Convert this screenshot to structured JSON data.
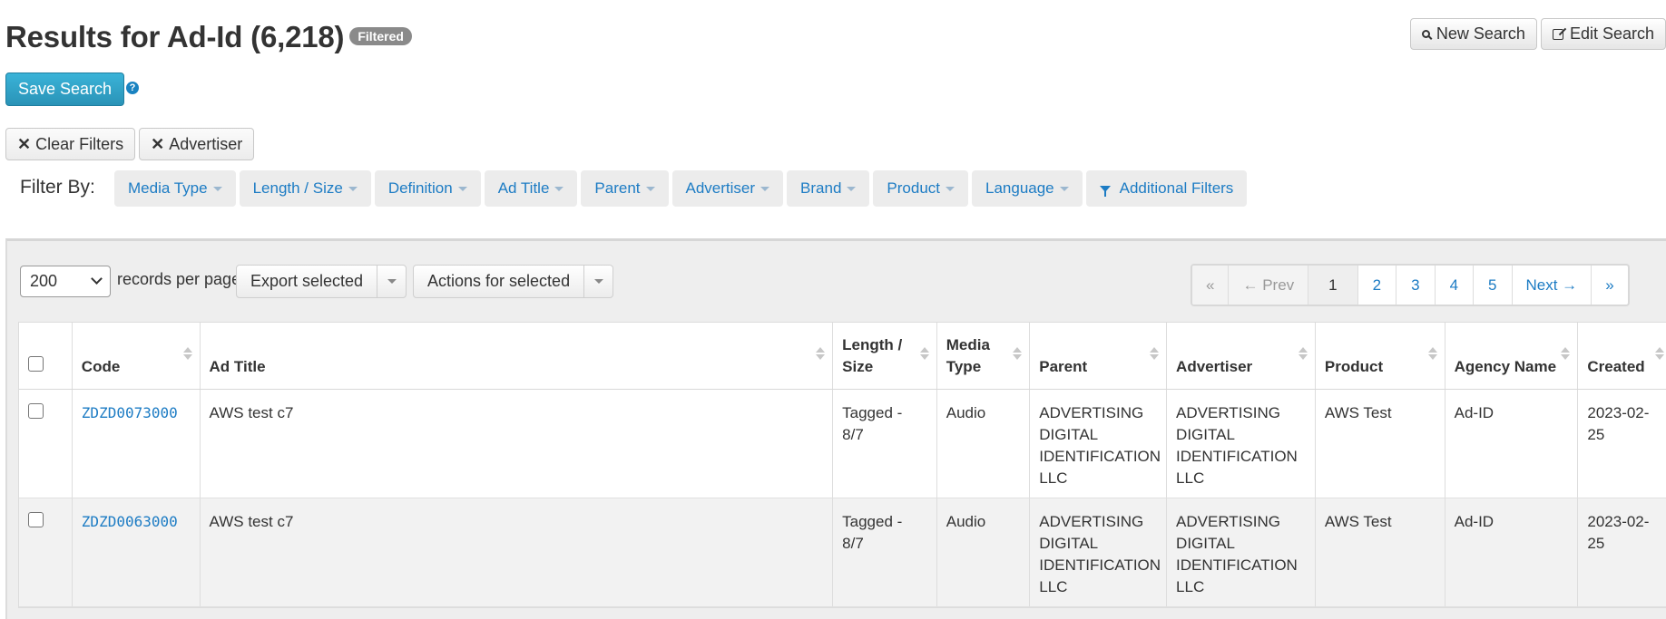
{
  "header": {
    "title": "Results for Ad-Id (6,218)",
    "badge": "Filtered",
    "new_search_label": "New Search",
    "edit_search_label": "Edit Search",
    "save_search_label": "Save Search",
    "help_icon": "question-circle-icon"
  },
  "active_filters": {
    "clear_label": "Clear Filters",
    "advertiser_label": "Advertiser"
  },
  "filter_by": {
    "label": "Filter By:",
    "items": [
      {
        "label": "Media Type"
      },
      {
        "label": "Length / Size"
      },
      {
        "label": "Definition"
      },
      {
        "label": "Ad Title"
      },
      {
        "label": "Parent"
      },
      {
        "label": "Advertiser"
      },
      {
        "label": "Brand"
      },
      {
        "label": "Product"
      },
      {
        "label": "Language"
      }
    ],
    "additional_label": "Additional Filters"
  },
  "toolbar": {
    "per_page_value": "200",
    "per_page_label": "records per page",
    "export_label": "Export selected",
    "actions_label": "Actions for selected"
  },
  "pagination": {
    "first": "«",
    "prev": "← Prev",
    "pages": [
      "1",
      "2",
      "3",
      "4",
      "5"
    ],
    "active_page": "1",
    "next": "Next →",
    "last": "»"
  },
  "table": {
    "columns": [
      "Code",
      "Ad Title",
      "Length / Size",
      "Media Type",
      "Parent",
      "Advertiser",
      "Product",
      "Agency Name",
      "Created"
    ],
    "rows": [
      {
        "code": "ZDZD0073000",
        "ad_title": "AWS test c7",
        "length_size": "Tagged - 8/7",
        "media_type": "Audio",
        "parent": "ADVERTISING DIGITAL IDENTIFICATION LLC",
        "advertiser": "ADVERTISING DIGITAL IDENTIFICATION LLC",
        "product": "AWS Test",
        "agency_name": "Ad-ID",
        "created": "2023-02-25"
      },
      {
        "code": "ZDZD0063000",
        "ad_title": "AWS test c7",
        "length_size": "Tagged - 8/7",
        "media_type": "Audio",
        "parent": "ADVERTISING DIGITAL IDENTIFICATION LLC",
        "advertiser": "ADVERTISING DIGITAL IDENTIFICATION LLC",
        "product": "AWS Test",
        "agency_name": "Ad-ID",
        "created": "2023-02-25"
      }
    ]
  },
  "colors": {
    "link": "#1d7cc4",
    "save_button": "#2fa4cb",
    "badge": "#8a8a8a"
  }
}
